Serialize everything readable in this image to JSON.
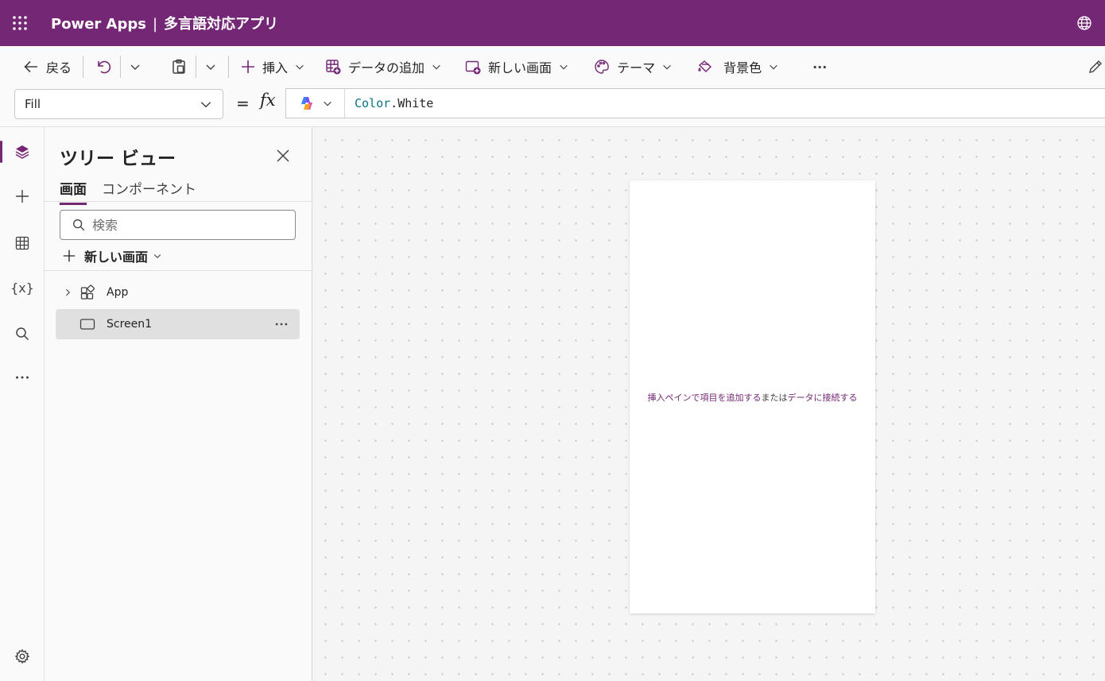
{
  "app": {
    "product": "Power Apps",
    "separator": "|",
    "name": "多言語対応アプリ"
  },
  "commandbar": {
    "back": "戻る",
    "insert": "挿入",
    "add_data": "データの追加",
    "new_screen": "新しい画面",
    "theme": "テーマ",
    "background": "背景色",
    "more": "···"
  },
  "formula": {
    "property": "Fill",
    "equals": "=",
    "fx": "fx",
    "object": "Color",
    "dot": ".",
    "member": "White"
  },
  "tree": {
    "title": "ツリー ビュー",
    "tabs": [
      "画面",
      "コンポーネント"
    ],
    "search_placeholder": "検索",
    "new_screen": "新しい画面",
    "items": [
      {
        "label": "App"
      },
      {
        "label": "Screen1"
      }
    ]
  },
  "canvas": {
    "hint_insert": "挿入ペインで項目を追加する",
    "hint_or": "または",
    "hint_data": "データに接続する"
  },
  "colors": {
    "brand": "#742774",
    "formula_keyword": "#0a7482"
  }
}
